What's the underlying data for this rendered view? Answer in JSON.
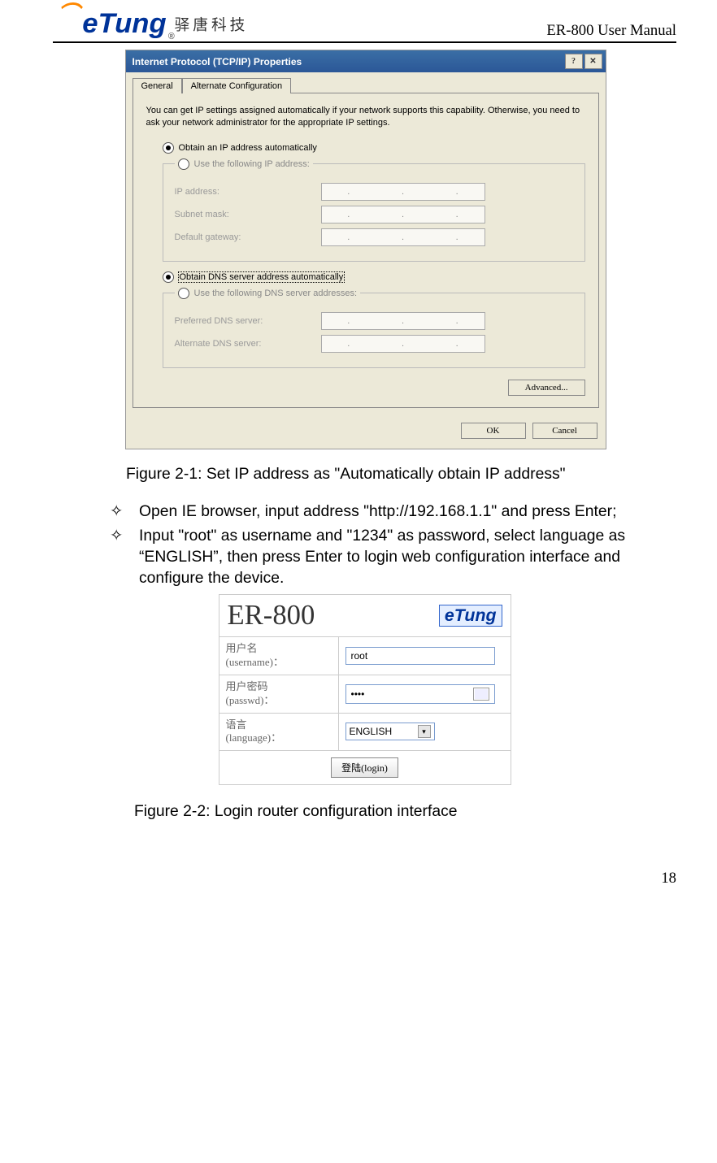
{
  "header": {
    "logo_text": "eTung",
    "logo_reg": "®",
    "logo_cn": "驿唐科技",
    "doc_title": "ER-800 User Manual"
  },
  "dialog": {
    "title": "Internet Protocol (TCP/IP) Properties",
    "help_btn": "?",
    "close_btn": "✕",
    "tabs": [
      "General",
      "Alternate Configuration"
    ],
    "desc": "You can get IP settings assigned automatically if your network supports this capability. Otherwise, you need to ask your network administrator for the appropriate IP settings.",
    "radio_auto_ip": "Obtain an IP address automatically",
    "radio_static_ip": "Use the following IP address:",
    "ip_address": "IP address:",
    "subnet": "Subnet mask:",
    "gateway": "Default gateway:",
    "radio_auto_dns": "Obtain DNS server address automatically",
    "radio_static_dns": "Use the following DNS server addresses:",
    "pref_dns": "Preferred DNS server:",
    "alt_dns": "Alternate DNS server:",
    "advanced": "Advanced...",
    "ok": "OK",
    "cancel": "Cancel"
  },
  "figure1_caption": "Figure 2-1: Set IP address as \"Automatically obtain IP address\"",
  "steps": {
    "bullet": "✧",
    "step1": "Open IE browser, input address \"http://192.168.1.1\" and press Enter;",
    "step2": "Input \"root\" as username and \"1234\" as password, select language as “ENGLISH”, then press Enter to login web configuration interface and configure the device."
  },
  "login": {
    "product": "ER-800",
    "small_logo": "eTung",
    "username_label": "用户名\n(username)：",
    "password_label": "用户密码\n(passwd)：",
    "language_label": "语言\n(language)：",
    "username_value": "root",
    "password_value": "••••",
    "language_value": "ENGLISH",
    "login_btn": "登陆(login)"
  },
  "figure2_caption": "Figure 2-2: Login router configuration interface",
  "page_number": "18"
}
